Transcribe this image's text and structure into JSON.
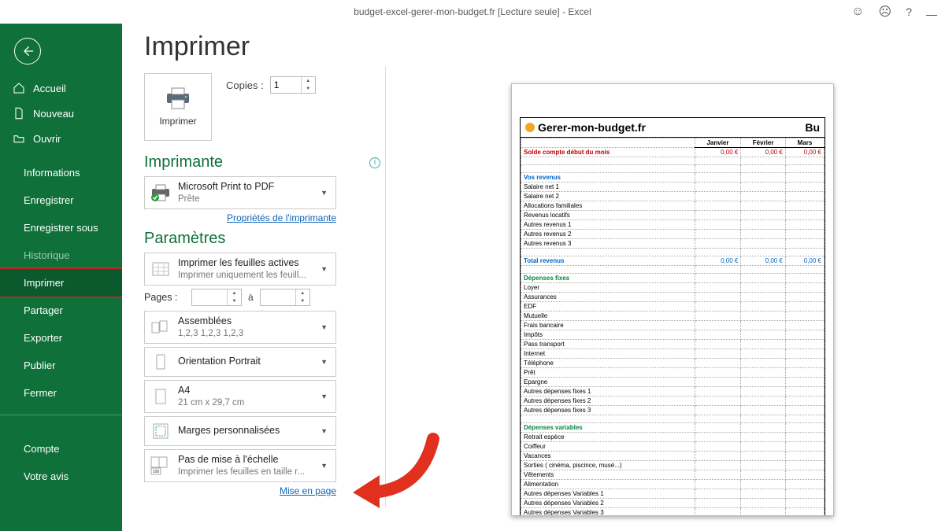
{
  "titlebar": {
    "title": "budget-excel-gerer-mon-budget.fr  [Lecture seule]  -  Excel"
  },
  "sidebar": {
    "accueil": "Accueil",
    "nouveau": "Nouveau",
    "ouvrir": "Ouvrir",
    "informations": "Informations",
    "enregistrer": "Enregistrer",
    "enregistrer_sous": "Enregistrer sous",
    "historique": "Historique",
    "imprimer": "Imprimer",
    "partager": "Partager",
    "exporter": "Exporter",
    "publier": "Publier",
    "fermer": "Fermer",
    "compte": "Compte",
    "votre_avis": "Votre avis"
  },
  "main": {
    "heading": "Imprimer",
    "print_button": "Imprimer",
    "copies_label": "Copies :",
    "copies_value": "1",
    "printer_heading": "Imprimante",
    "printer": {
      "name": "Microsoft Print to PDF",
      "status": "Prête"
    },
    "printer_props_link": "Propriétés de l'imprimante",
    "settings_heading": "Paramètres",
    "active_sheets": {
      "row1": "Imprimer les feuilles actives",
      "row2": "Imprimer uniquement les feuill..."
    },
    "pages_label": "Pages :",
    "pages_a": "à",
    "collate": {
      "row1": "Assemblées",
      "row2": "1,2,3    1,2,3    1,2,3"
    },
    "orientation": {
      "row1": "Orientation Portrait"
    },
    "paper": {
      "row1": "A4",
      "row2": "21 cm x 29,7 cm"
    },
    "margins": {
      "row1": "Marges personnalisées"
    },
    "scaling": {
      "row1": "Pas de mise à l'échelle",
      "row2": "Imprimer les feuilles en taille r..."
    },
    "scaling_badge": "100",
    "page_setup_link": "Mise en page"
  },
  "preview": {
    "brand": "Gerer-mon-budget.fr",
    "bu_cut": "Bu",
    "months": [
      "Janvier",
      "Février",
      "Mars"
    ],
    "solde_row": "Solde compte début du mois",
    "solde_val": "0,00 €",
    "vos_revenus": "Vos revenus",
    "rev_rows": [
      "Salaire net 1",
      "Salaire net 2",
      "Allocations familiales",
      "Revenus locatifs",
      "Autres revenus 1",
      "Autres revenus 2",
      "Autres revenus 3"
    ],
    "total_revenus": "Total revenus",
    "total_val": "0,00 €",
    "dep_fixes": "Dépenses fixes",
    "fix_rows": [
      "Loyer",
      "Assurances",
      "EDF",
      "Mutuelle",
      "Frais bancaire",
      "Impôts",
      "Pass transport",
      "Internet",
      "Téléphone",
      "Prêt",
      "Epargne",
      "Autres dépenses fixes 1",
      "Autres dépenses fixes 2",
      "Autres dépenses fixes 3"
    ],
    "dep_var": "Dépenses variables",
    "var_rows": [
      "Retrait espèce",
      "Coiffeur",
      "Vacances",
      "Sorties ( cinéma, piscince, musé...)",
      "Vêtements",
      "Alimentation",
      "Autres dépenses Variables 1",
      "Autres dépenses Variables 2",
      "Autres dépenses Variables 3"
    ]
  }
}
